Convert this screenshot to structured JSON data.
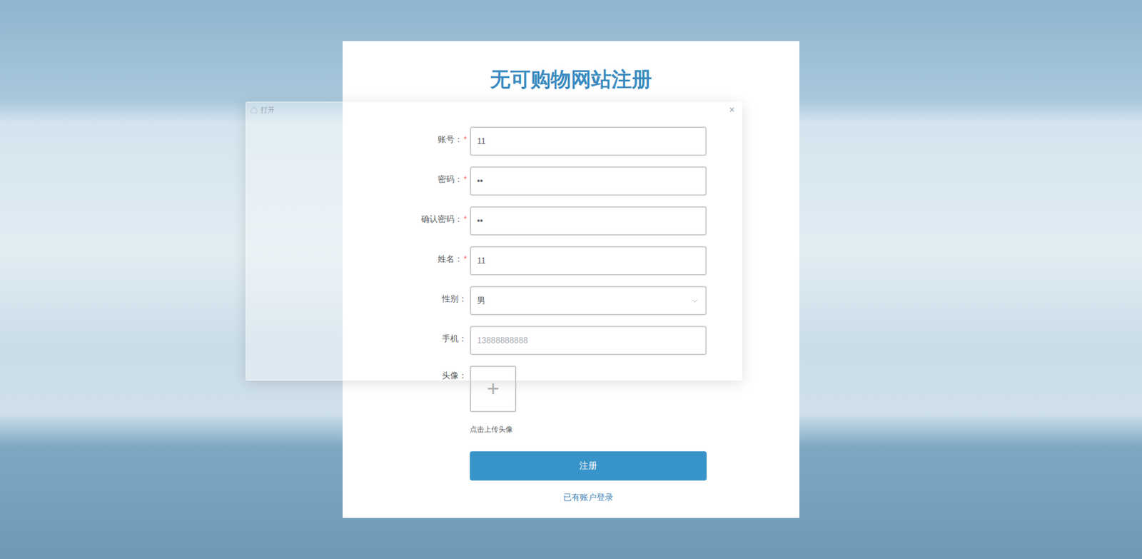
{
  "page": {
    "title": "无可购物网站注册"
  },
  "dialog": {
    "title": "打开",
    "close": "×"
  },
  "form": {
    "required_mark": "*",
    "fields": [
      {
        "label": "账号：",
        "required": true,
        "kind": "input",
        "value": "11",
        "placeholder": false
      },
      {
        "label": "密码：",
        "required": true,
        "kind": "input",
        "value": "••",
        "placeholder": false
      },
      {
        "label": "确认密码：",
        "required": true,
        "kind": "input",
        "value": "••",
        "placeholder": false
      },
      {
        "label": "姓名：",
        "required": true,
        "kind": "input",
        "value": "11",
        "placeholder": false
      },
      {
        "label": "性别：",
        "required": false,
        "kind": "select",
        "value": "男",
        "placeholder": false
      },
      {
        "label": "手机：",
        "required": false,
        "kind": "input",
        "value": "13888888888",
        "placeholder": true
      }
    ],
    "avatar": {
      "label": "头像：",
      "icon": "+",
      "hint": "点击上传头像"
    }
  },
  "submit": "注册",
  "login_link": "已有账户登录"
}
